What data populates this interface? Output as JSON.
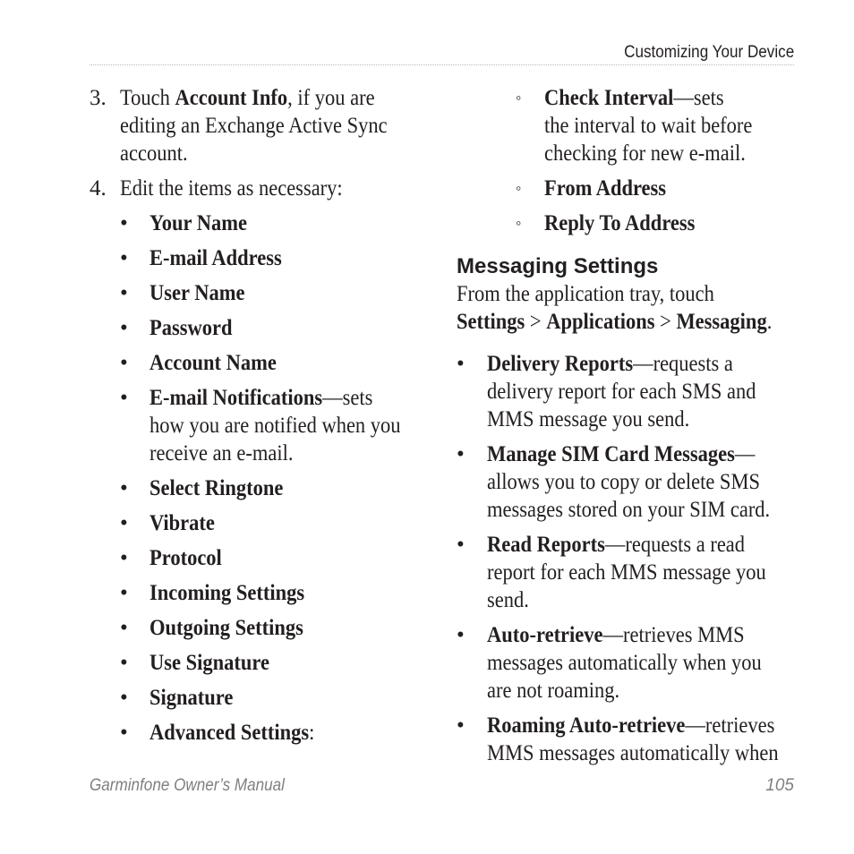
{
  "header": {
    "title": "Customizing Your Device"
  },
  "left": {
    "step3": {
      "num": "3.",
      "pre": "Touch ",
      "bold": "Account Info",
      "line1_rest": ", if you are",
      "line2": "editing an Exchange Active Sync",
      "line3": "account."
    },
    "step4": {
      "num": "4.",
      "text": "Edit the items as necessary:"
    },
    "bullets": [
      "Your Name",
      "E-mail Address",
      "User Name",
      "Password",
      "Account Name"
    ],
    "notif": {
      "bold": "E-mail Notifications",
      "rest": "—sets",
      "line2": "how you are notified when you",
      "line3": "receive an e-mail."
    },
    "bullets2": [
      "Select Ringtone",
      "Vibrate",
      "Protocol",
      "Incoming Settings",
      "Outgoing Settings",
      "Use Signature",
      "Signature"
    ],
    "advanced": {
      "bold": "Advanced Settings",
      "rest": ":"
    },
    "bullet_glyph": "•"
  },
  "right": {
    "circle_glyph": "◦",
    "check": {
      "bold": "Check Interval",
      "rest": "—sets",
      "line2": "the interval to wait before",
      "line3": "checking for new e-mail."
    },
    "from": "From Address",
    "reply": "Reply To Address",
    "heading": "Messaging Settings",
    "intro_line1": "From the application tray, touch",
    "path": {
      "p1": "Settings",
      "sep1": " > ",
      "p2": "Applications",
      "sep2": " > ",
      "p3": "Messaging",
      "end": "."
    },
    "items": [
      {
        "bold": "Delivery Reports",
        "rest": "—requests a",
        "lines": [
          "delivery report for each SMS and",
          "MMS message you send."
        ]
      },
      {
        "bold": "Manage SIM Card Messages",
        "rest": "—",
        "lines": [
          "allows you to copy or delete SMS",
          "messages stored on your SIM card."
        ]
      },
      {
        "bold": "Read Reports",
        "rest": "—requests a read",
        "lines": [
          "report for each MMS message you",
          "send."
        ]
      },
      {
        "bold": "Auto-retrieve",
        "rest": "—retrieves MMS",
        "lines": [
          "messages automatically when you",
          "are not roaming."
        ]
      },
      {
        "bold": "Roaming Auto-retrieve",
        "rest": "—retrieves",
        "lines": [
          "MMS messages automatically when"
        ]
      }
    ]
  },
  "footer": {
    "manual": "Garminfone Owner’s Manual",
    "page": "105"
  }
}
